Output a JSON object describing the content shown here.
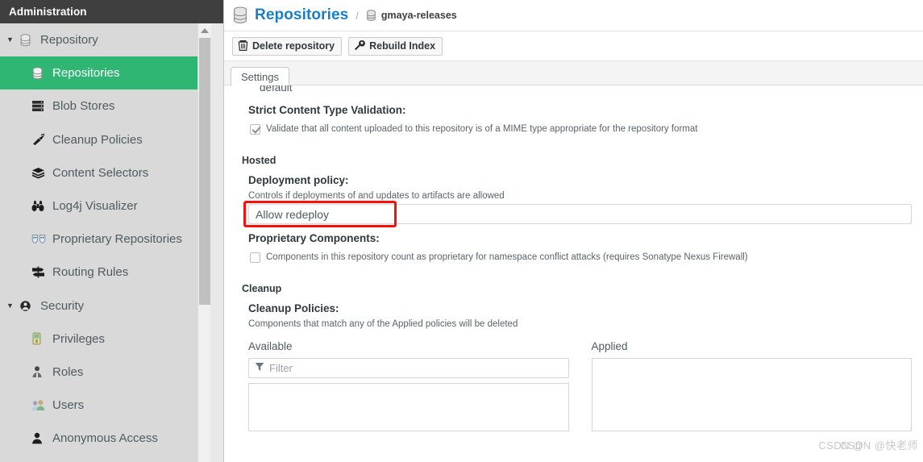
{
  "sidebar": {
    "header_title": "Administration",
    "items": [
      {
        "label": "Repository",
        "icon": "database-icon",
        "type": "group",
        "expanded": true,
        "selected": false
      },
      {
        "label": "Repositories",
        "icon": "database-icon",
        "type": "child",
        "selected": true
      },
      {
        "label": "Blob Stores",
        "icon": "server-stack-icon",
        "type": "child",
        "selected": false
      },
      {
        "label": "Cleanup Policies",
        "icon": "broom-icon",
        "type": "child",
        "selected": false
      },
      {
        "label": "Content Selectors",
        "icon": "layers-icon",
        "type": "child",
        "selected": false
      },
      {
        "label": "Log4j Visualizer",
        "icon": "binoculars-icon",
        "type": "child",
        "selected": false
      },
      {
        "label": "Proprietary Repositories",
        "icon": "masks-icon",
        "type": "child",
        "selected": false
      },
      {
        "label": "Routing Rules",
        "icon": "signpost-icon",
        "type": "child",
        "selected": false
      },
      {
        "label": "Security",
        "icon": "shield-person-icon",
        "type": "group",
        "expanded": true,
        "selected": false
      },
      {
        "label": "Privileges",
        "icon": "key-card-icon",
        "type": "child",
        "selected": false
      },
      {
        "label": "Roles",
        "icon": "person-badge-icon",
        "type": "child",
        "selected": false
      },
      {
        "label": "Users",
        "icon": "people-icon",
        "type": "child",
        "selected": false
      },
      {
        "label": "Anonymous Access",
        "icon": "person-icon",
        "type": "child",
        "selected": false
      }
    ],
    "caret_glyph": "▼",
    "selected_color": "#2fb673"
  },
  "breadcrumb": {
    "title": "Repositories",
    "separator": "/",
    "current": "gmaya-releases",
    "title_color": "#1a7ec8"
  },
  "toolbar": {
    "delete_label": "Delete repository",
    "rebuild_label": "Rebuild Index"
  },
  "tabs": [
    {
      "label": "Settings",
      "active": true
    }
  ],
  "form": {
    "cut_off_value": "default",
    "strict_content_type": {
      "label": "Strict Content Type Validation:",
      "checkbox_text": "Validate that all content uploaded to this repository is of a MIME type appropriate for the repository format",
      "checked": true
    },
    "hosted_section": "Hosted",
    "deployment_policy": {
      "label": "Deployment policy:",
      "hint": "Controls if deployments of and updates to artifacts are allowed",
      "value": "Allow redeploy",
      "highlight_color": "#fa0f0a"
    },
    "proprietary_components": {
      "label": "Proprietary Components:",
      "checkbox_text": "Components in this repository count as proprietary for namespace conflict attacks (requires Sonatype Nexus Firewall)",
      "checked": false
    },
    "cleanup_section": "Cleanup",
    "cleanup_policies": {
      "label": "Cleanup Policies:",
      "hint": "Components that match any of the Applied policies will be deleted",
      "available_title": "Available",
      "applied_title": "Applied",
      "filter_placeholder": "Filter",
      "filter_value": ""
    }
  },
  "watermark": {
    "text_a": "CSDN @",
    "text_b": "CSDN @快老师"
  }
}
